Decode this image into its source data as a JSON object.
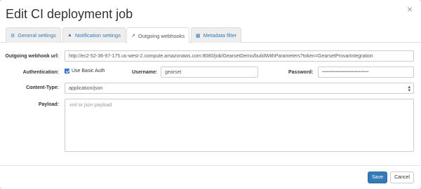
{
  "dialog": {
    "title": "Edit CI deployment job",
    "close_glyph": "×"
  },
  "tabs": [
    {
      "label": "General settings",
      "icon": "gear-icon",
      "glyph": "⚙",
      "active": false
    },
    {
      "label": "Notification settings",
      "icon": "bell-icon",
      "glyph": "🔔",
      "active": false
    },
    {
      "label": "Outgoing webhooks",
      "icon": "share-icon",
      "glyph": "↗",
      "active": true
    },
    {
      "label": "Metadata filter",
      "icon": "table-icon",
      "glyph": "▦",
      "active": false
    }
  ],
  "form": {
    "webhook_url_label": "Outgoing webhook url:",
    "webhook_url_value": "http://ec2-52-36-97-175.us-west-2.compute.amazonaws.com:8080/job/GearsetDemo/buildWithParameters?token=GearsetProvarIntegration",
    "authentication_label": "Authentication:",
    "basic_auth_label": "Use Basic Auth",
    "basic_auth_checked": true,
    "username_label": "Username:",
    "username_value": "gearset",
    "password_label": "Password:",
    "password_value": "••••••••••••••••••••••••••••••••••",
    "content_type_label": "Content-Type:",
    "content_type_value": "application/json",
    "payload_label": "Payload:",
    "payload_placeholder": "xml or json payload"
  },
  "footer": {
    "save_label": "Save",
    "cancel_label": "Cancel"
  },
  "colors": {
    "primary": "#337ab7",
    "tab_link": "#337ab7"
  }
}
